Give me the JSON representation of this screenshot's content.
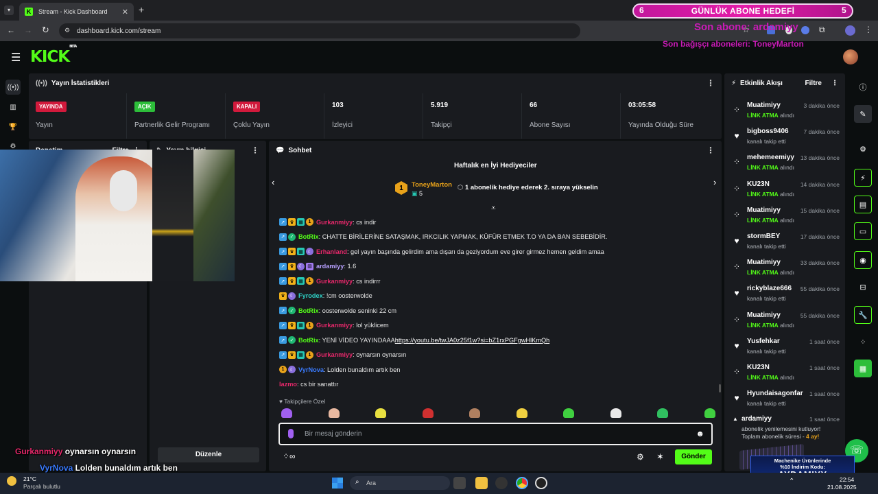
{
  "browser": {
    "tab_title": "Stream - Kick Dashboard",
    "url": "dashboard.kick.com/stream"
  },
  "app": {
    "logo": "KICK",
    "logo_sup": "BETA"
  },
  "overlay": {
    "goal_left": "6",
    "goal_title": "GÜNLÜK ABONE HEDEFİ",
    "goal_right": "5",
    "last_sub": "Son abone: ardamiyy",
    "last_gift": "Son bağışçı aboneleri: ToneyMarton",
    "promo_line1": "Machenike Ürünlerinde",
    "promo_line2": "%10 İndirim Kodu:",
    "promo_code": "AYDAMIYY"
  },
  "stats": {
    "title": "Yayın İstatistikleri",
    "items": [
      {
        "badge": "YAYINDA",
        "badge_color": "#d21a3c",
        "label": "Yayın"
      },
      {
        "badge": "AÇIK",
        "badge_color": "#2dbe3a",
        "label": "Partnerlik Gelir Programı"
      },
      {
        "badge": "KAPALI",
        "badge_color": "#d21a3c",
        "label": "Çoklu Yayın"
      },
      {
        "value": "103",
        "label": "İzleyici"
      },
      {
        "value": "5.919",
        "label": "Takipçi"
      },
      {
        "value": "66",
        "label": "Abone Sayısı"
      },
      {
        "value": "03:05:58",
        "label": "Yayında Olduğu Süre"
      }
    ]
  },
  "mod_panel": {
    "title": "Denetim",
    "filter": "Filtre"
  },
  "info_panel": {
    "title": "Yayın bilgisi"
  },
  "chat": {
    "title": "Sohbet",
    "top_gifters_title": "Haftalık en İyi Hediyeciler",
    "top_gifter_rank": "1",
    "top_gifter_name": "ToneyMarton",
    "top_gifter_count": "5",
    "top_gifter_hint": "1 abonelik hediye ederek 2. sıraya yükselin",
    "messages": [
      {
        "user": "Gurkanmiyy",
        "color": "#e8286b",
        "badges": [
          "vip",
          "crown",
          "og",
          "sub"
        ],
        "text": ": cs indir"
      },
      {
        "user": "BotRix",
        "color": "#53fc18",
        "badges": [
          "vip",
          "mod"
        ],
        "text": ": CHATTE BİRİLERİNE SATAŞMAK, IRKCILIK YAPMAK, KÜFÜR ETMEK T.O YA DA BAN SEBEBİDİR."
      },
      {
        "user": "Erhanland",
        "color": "#e8286b",
        "badges": [
          "vip",
          "crown",
          "og",
          "dj"
        ],
        "text": ": gel yayın başında gelirdim ama dışarı da geziyordum eve girer girmez hemen geldim amaa"
      },
      {
        "user": "ardamiyy",
        "color": "#b7a0ff",
        "badges": [
          "vip",
          "crown",
          "dj",
          "purple"
        ],
        "text": ": 1.6"
      },
      {
        "user": "Gurkanmiyy",
        "color": "#e8286b",
        "badges": [
          "vip",
          "crown",
          "og",
          "sub"
        ],
        "text": ": cs indirrr"
      },
      {
        "user": "Fyrodex",
        "color": "#2fd3c8",
        "badges": [
          "crown",
          "dj"
        ],
        "text": ": !cm oosterwolde"
      },
      {
        "user": "BotRix",
        "color": "#53fc18",
        "badges": [
          "vip",
          "mod"
        ],
        "text": ": oosterwolde seninki 22 cm"
      },
      {
        "user": "Gurkanmiyy",
        "color": "#e8286b",
        "badges": [
          "vip",
          "crown",
          "og",
          "sub"
        ],
        "text": ": lol yüklicem"
      },
      {
        "user": "BotRix",
        "color": "#53fc18",
        "badges": [
          "vip",
          "mod"
        ],
        "text": ": YENİ VİDEO YAYINDAAA ",
        "link": "https://youtu.be/twJA0z25f1w?si=bZ1rxPGFgwHlKmQh"
      },
      {
        "user": "Gurkanmiyy",
        "color": "#e8286b",
        "badges": [
          "vip",
          "crown",
          "og",
          "sub"
        ],
        "text": ": oynarsın oynarsın"
      },
      {
        "user": "VyrNova",
        "color": "#3a7bff",
        "badges": [
          "sub",
          "dj"
        ],
        "text": ": Lolden bunaldım artık ben"
      },
      {
        "user": "lazmo",
        "color": "#e8286b",
        "badges": [],
        "text": ": cs bir sanattır"
      }
    ],
    "emote_section": "Takipçilere Özel",
    "input_placeholder": "Bir mesaj gönderin",
    "send_label": "Gönder"
  },
  "activity": {
    "title": "Etkinlik Akışı",
    "filter": "Filtre",
    "events": [
      {
        "icon": "gift",
        "name": "Muatimiyy",
        "time": "3 dakika önce",
        "hl": "LİNK ATMA",
        "rest": " alındı"
      },
      {
        "icon": "heart",
        "name": "bigboss9406",
        "time": "7 dakika önce",
        "hl": "",
        "rest": "kanalı takip etti"
      },
      {
        "icon": "gift",
        "name": "mehemeemiyy",
        "time": "13 dakika önce",
        "hl": "LİNK ATMA",
        "rest": " alındı"
      },
      {
        "icon": "gift",
        "name": "KU23N",
        "time": "14 dakika önce",
        "hl": "LİNK ATMA",
        "rest": " alındı"
      },
      {
        "icon": "gift",
        "name": "Muatimiyy",
        "time": "15 dakika önce",
        "hl": "LİNK ATMA",
        "rest": " alındı"
      },
      {
        "icon": "heart",
        "name": "stormBEY",
        "time": "17 dakika önce",
        "hl": "",
        "rest": "kanalı takip etti"
      },
      {
        "icon": "gift",
        "name": "Muatimiyy",
        "time": "33 dakika önce",
        "hl": "LİNK ATMA",
        "rest": " alındı"
      },
      {
        "icon": "heart",
        "name": "rickyblaze666",
        "time": "55 dakika önce",
        "hl": "",
        "rest": "kanalı takip etti"
      },
      {
        "icon": "gift",
        "name": "Muatimiyy",
        "time": "55 dakika önce",
        "hl": "LİNK ATMA",
        "rest": " alındı"
      },
      {
        "icon": "heart",
        "name": "Yusfehkar",
        "time": "1 saat önce",
        "hl": "",
        "rest": "kanalı takip etti"
      },
      {
        "icon": "gift",
        "name": "KU23N",
        "time": "1 saat önce",
        "hl": "LİNK ATMA",
        "rest": " alındı"
      },
      {
        "icon": "heart",
        "name": "Hyundaisagonfar",
        "time": "1 saat önce",
        "hl": "",
        "rest": "kanalı takip etti"
      }
    ],
    "last": {
      "name": "ardamiyy",
      "time": "1 saat önce",
      "line1": "abonelik yenilemesini kutluyor!",
      "line2a": "Toplam abonelik süresi - ",
      "line2b": "4 ay!"
    }
  },
  "overlay_chat": [
    {
      "user": "Gurkanmiyy",
      "color": "#e8286b",
      "text": " oynarsın oynarsın"
    },
    {
      "user": "VyrNova",
      "color": "#3a7bff",
      "text": " Lolden bunaldım artık ben"
    },
    {
      "user": "lazmo",
      "color": "#e8286b",
      "text": " cs bir sanattır"
    }
  ],
  "edit_button": "Düzenle",
  "taskbar": {
    "weather_temp": "21°C",
    "weather_desc": "Parçalı bulutlu",
    "search": "Ara",
    "time": "22:54",
    "date": "21.08.2025"
  }
}
